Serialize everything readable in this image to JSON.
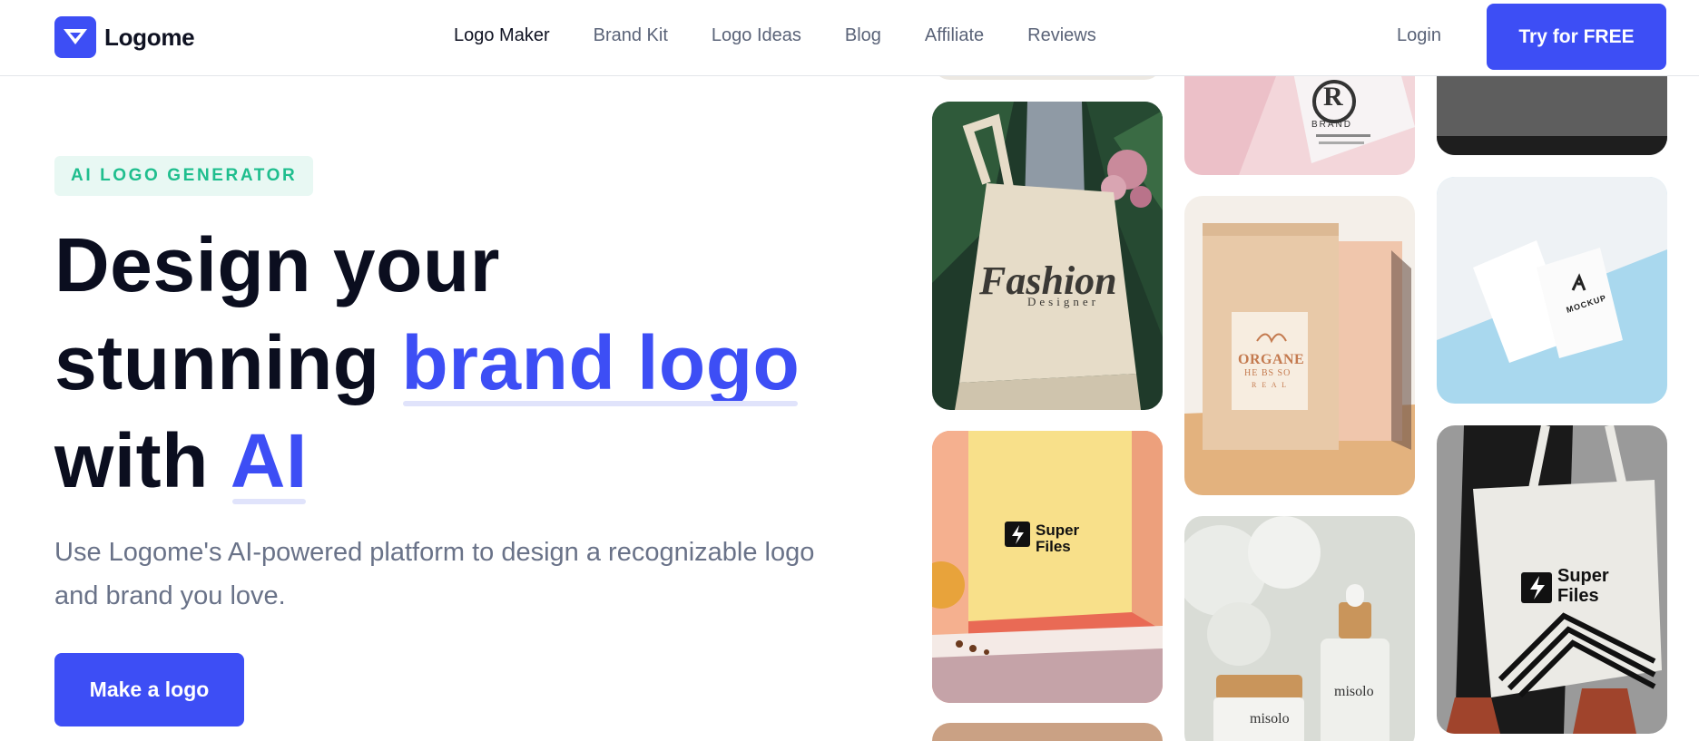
{
  "header": {
    "brand_name": "Logome",
    "logo_icon": "logome-heart-icon",
    "nav": [
      {
        "label": "Logo Maker",
        "active": true
      },
      {
        "label": "Brand Kit",
        "active": false
      },
      {
        "label": "Logo Ideas",
        "active": false
      },
      {
        "label": "Blog",
        "active": false
      },
      {
        "label": "Affiliate",
        "active": false
      },
      {
        "label": "Reviews",
        "active": false
      }
    ],
    "login_label": "Login",
    "cta_label": "Try for FREE"
  },
  "hero": {
    "badge": "AI LOGO GENERATOR",
    "headline_line1": "Design your",
    "headline_line2_plain": "stunning ",
    "headline_line2_accent": "brand logo",
    "headline_line3_plain": "with ",
    "headline_line3_accent": "AI",
    "subtitle": "Use Logome's AI-powered platform to design a recognizable logo and brand you love.",
    "cta_label": "Make a logo"
  },
  "gallery": {
    "fashion_tote": {
      "title": "Fashion",
      "subtitle": "Designer"
    },
    "superfiles_box": {
      "line1": "Super",
      "line2": "Files"
    },
    "business_card": {
      "letter": "R",
      "word": "BRAND"
    },
    "organic_bag": {
      "title": "ORGANE",
      "line2": "HE BS SO",
      "line3": "R E A L"
    },
    "misolo_jars": {
      "brand": "misolo"
    },
    "mockup_cards": {
      "word": "MOCKUP"
    },
    "superfiles_tote": {
      "line1": "Super",
      "line2": "Files"
    }
  },
  "colors": {
    "brand_blue": "#3d4ef5",
    "badge_green": "#1fbe8e",
    "badge_bg": "#e8f8f3",
    "heading": "#0b0e1f",
    "muted_text": "#697288"
  }
}
